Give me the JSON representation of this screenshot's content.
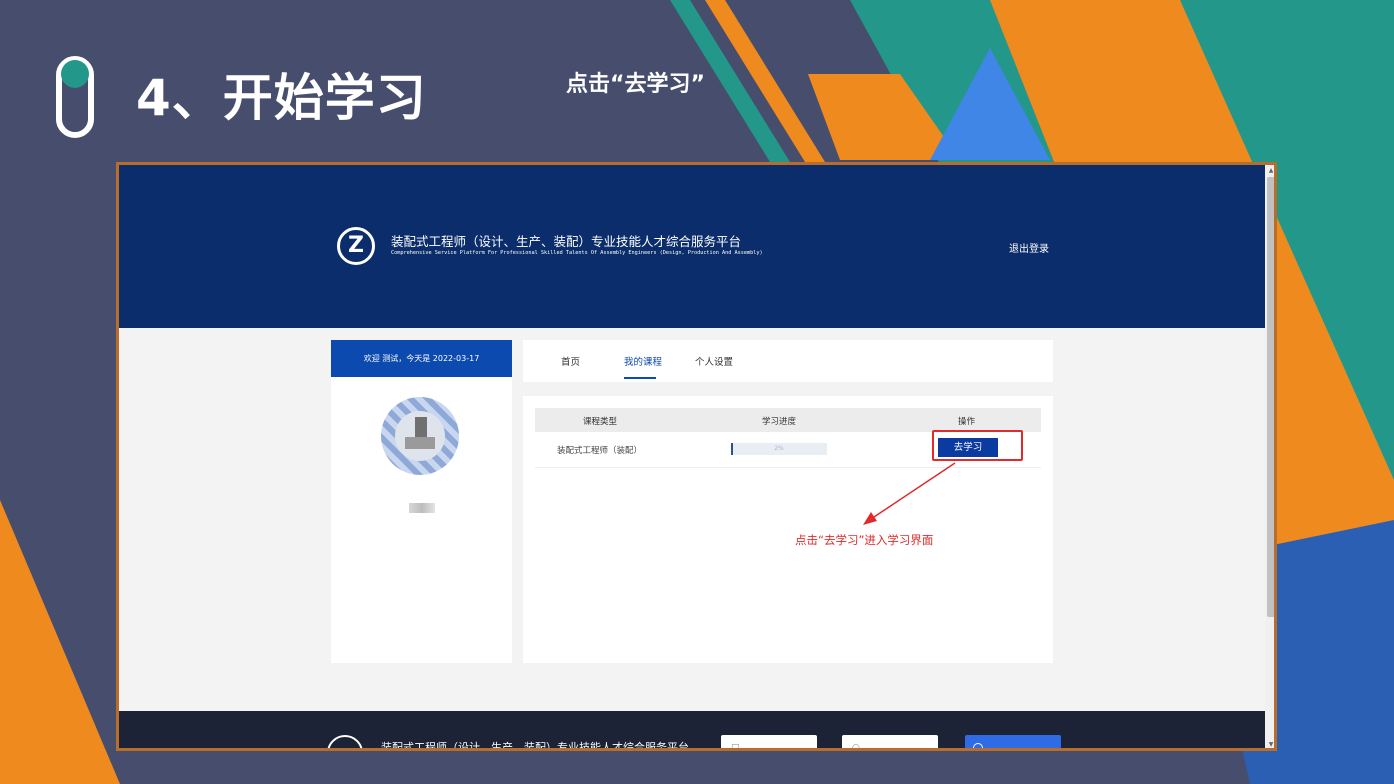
{
  "slide": {
    "title": "4、开始学习",
    "subtitle": "点击“去学习”"
  },
  "site": {
    "logo_letter": "Z",
    "title": "装配式工程师（设计、生产、装配）专业技能人才综合服务平台",
    "subtitle": "Comprehensive Service Platform For Professional Skilled Talents Of Assembly Engineers (Design, Production And Assembly)",
    "logout": "退出登录"
  },
  "profile": {
    "welcome": "欢迎 测试，今天是 2022-03-17"
  },
  "tabs": [
    {
      "label": "首页"
    },
    {
      "label": "我的课程"
    },
    {
      "label": "个人设置"
    }
  ],
  "table": {
    "headers": [
      "课程类型",
      "学习进度",
      "操作"
    ],
    "rows": [
      {
        "type": "装配式工程师（装配）",
        "progress_text": "2%",
        "progress_value": 0.02,
        "action": "去学习"
      }
    ]
  },
  "annotation": "点击“去学习”进入学习界面",
  "footer": {
    "title": "装配式工程师（设计、生产、装配）专业技能人才综合服务平台"
  },
  "colors": {
    "header_bg": "#0b2d6b",
    "accent_blue": "#0c4ab0",
    "highlight_red": "#e22a2a",
    "bg_orange": "#ef8a1f",
    "bg_teal": "#22978a",
    "slide_bg": "#474d6c"
  },
  "icons": {
    "slide_marker": "pill-icon",
    "scroll_up": "triangle-up-icon",
    "scroll_down": "triangle-down-icon",
    "annotation_arrow": "arrow-icon"
  }
}
